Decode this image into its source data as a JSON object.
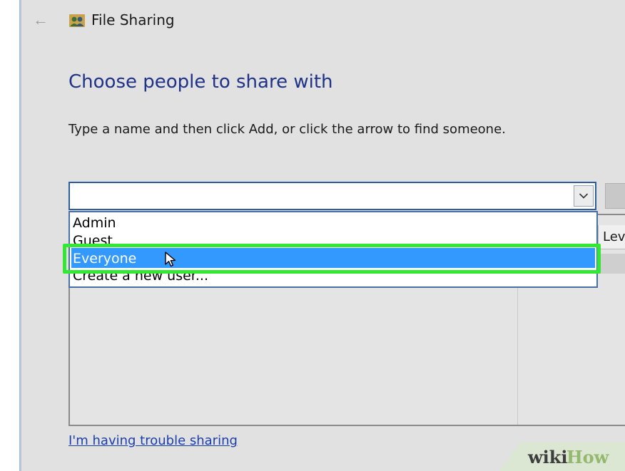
{
  "window": {
    "title": "File Sharing"
  },
  "icons": {
    "back": "back-arrow-icon",
    "title": "users-share-icon",
    "dropdown_arrow": "chevron-down-icon",
    "cursor": "mouse-pointer-icon"
  },
  "main": {
    "heading": "Choose people to share with",
    "instruction": "Type a name and then click Add, or click the arrow to find someone.",
    "combo_value": "",
    "level_column_partial": "Lev",
    "trouble_link": "I'm having trouble sharing"
  },
  "dropdown": {
    "items": [
      {
        "label": "Admin"
      },
      {
        "label": "Guest"
      },
      {
        "label": "Everyone"
      },
      {
        "label": "Create a new user..."
      }
    ],
    "selected": "Everyone"
  },
  "watermark": {
    "text_wiki": "wiki",
    "text_how": "How"
  },
  "colors": {
    "heading": "#1e3287",
    "highlight": "#3399ff",
    "annotation_box": "#33e833",
    "link": "#1a3ea8"
  }
}
